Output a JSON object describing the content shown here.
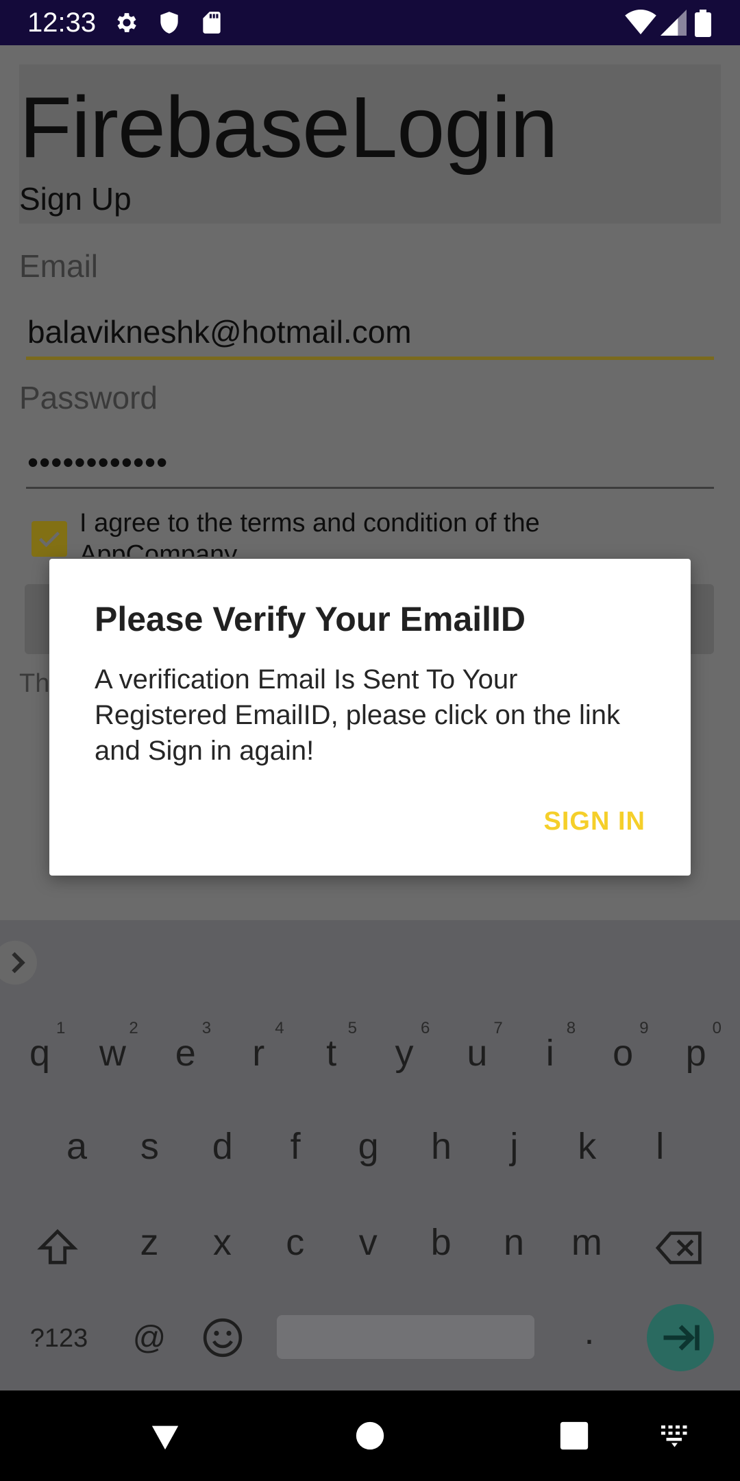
{
  "status_bar": {
    "time": "12:33",
    "icons_left": [
      "gear-icon",
      "shield-icon",
      "sd-card-icon"
    ],
    "icons_right": [
      "wifi-icon",
      "signal-icon",
      "battery-icon"
    ]
  },
  "app": {
    "title": "FirebaseLogin",
    "subtitle": "Sign Up",
    "email_label": "Email",
    "email_value": "balavikneshk@hotmail.com",
    "password_label": "Password",
    "password_value": "••••••••••••",
    "terms_checked": true,
    "terms_text": "I agree to the terms and condition of the AppCompany",
    "partial_text": "Th"
  },
  "dialog": {
    "title": "Please Verify Your EmailID",
    "message": "A verification Email Is Sent To Your Registered EmailID, please click on the link and Sign in again!",
    "button_label": "SIGN IN"
  },
  "keyboard": {
    "row1": [
      "q",
      "w",
      "e",
      "r",
      "t",
      "y",
      "u",
      "i",
      "o",
      "p"
    ],
    "row1_numbers": [
      "1",
      "2",
      "3",
      "4",
      "5",
      "6",
      "7",
      "8",
      "9",
      "0"
    ],
    "row2": [
      "a",
      "s",
      "d",
      "f",
      "g",
      "h",
      "j",
      "k",
      "l"
    ],
    "row3": [
      "z",
      "x",
      "c",
      "v",
      "b",
      "n",
      "m"
    ],
    "symbols_key": "?123",
    "at_key": "@",
    "period_key": "."
  },
  "colors": {
    "accent": "#f5cf2a",
    "status_bar": "#140a3a",
    "dialog_bg": "#ffffff"
  }
}
